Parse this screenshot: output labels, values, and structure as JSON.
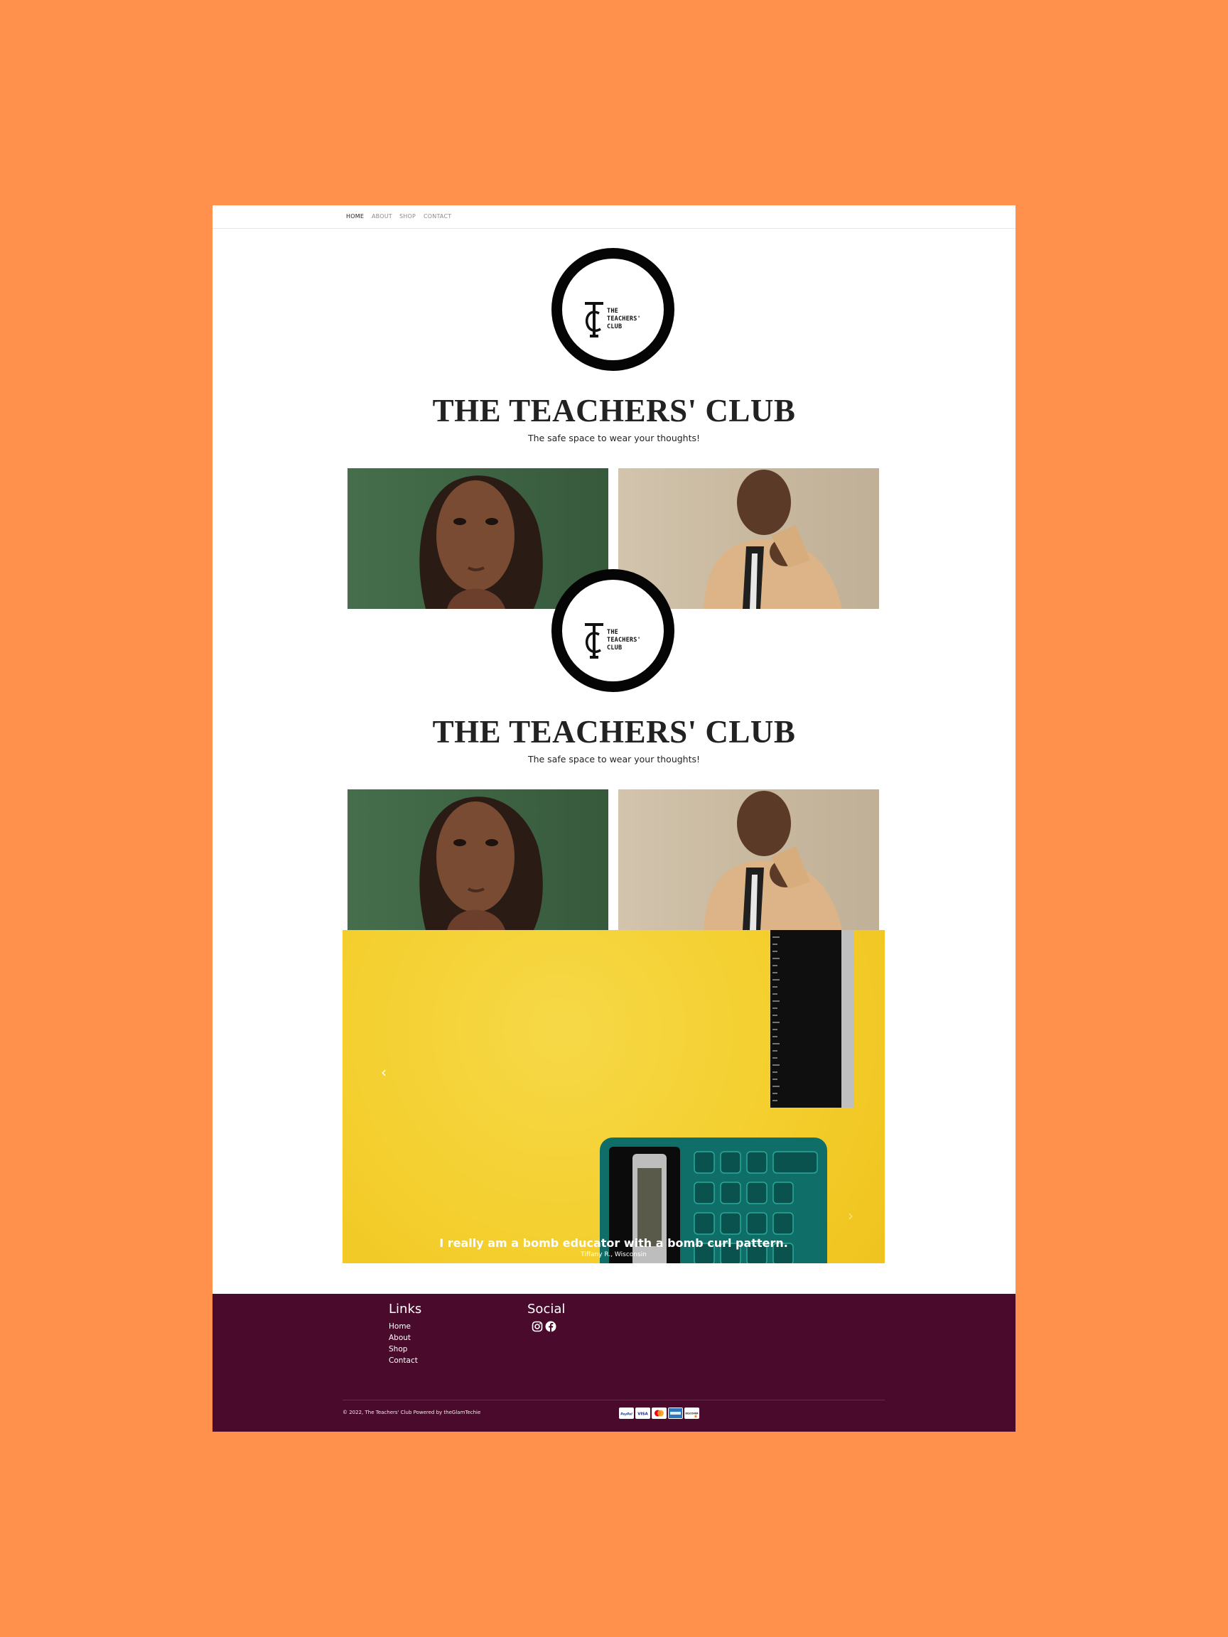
{
  "nav": {
    "items": [
      {
        "label": "HOME",
        "active": true
      },
      {
        "label": "ABOUT",
        "active": false
      },
      {
        "label": "SHOP",
        "active": false
      },
      {
        "label": "CONTACT",
        "active": false
      }
    ]
  },
  "logo": {
    "text": "THE\nTEACHERS'\nCLUB"
  },
  "site": {
    "title": "THE TEACHERS' CLUB",
    "tagline": "The safe space to wear your thoughts!"
  },
  "carousel": {
    "quote": "I really am a bomb educator with a bomb curl pattern.",
    "author": "Tiffany R., Wisconsin",
    "prev_icon": "chevron-left-icon",
    "next_icon": "chevron-right-icon"
  },
  "footer": {
    "links_heading": "Links",
    "links": [
      "Home",
      "About",
      "Shop",
      "Contact"
    ],
    "social_heading": "Social",
    "social_icons": [
      "instagram-icon",
      "facebook-icon"
    ],
    "copyright": "© 2022, The Teachers' Club Powered by theGlamTechie",
    "payments": [
      "PayPal",
      "VISA",
      "Mastercard",
      "American Express",
      "DISCOVER"
    ]
  },
  "colors": {
    "background": "#ff914d",
    "footer": "#4a0a2b",
    "carousel": "#f4cf2e",
    "title": "#222222"
  }
}
